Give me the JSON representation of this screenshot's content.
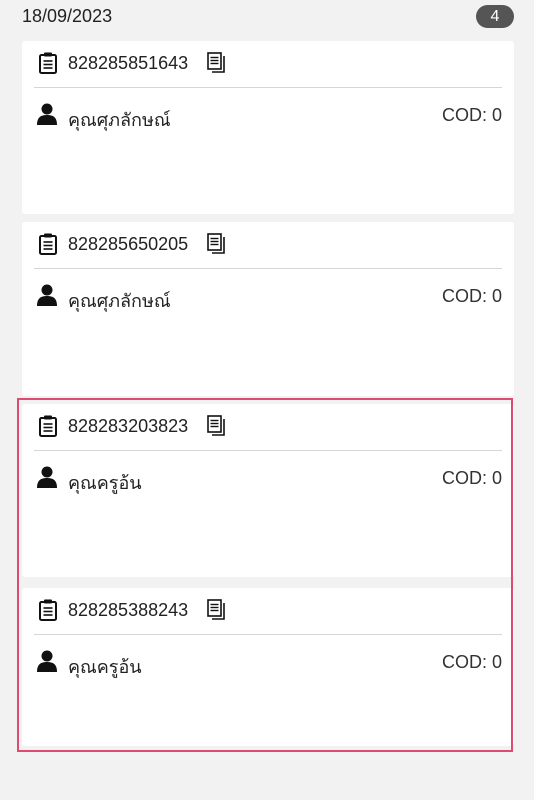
{
  "header": {
    "date": "18/09/2023",
    "count": "4"
  },
  "icons": {
    "clipboard": "clipboard-icon",
    "copy": "copy-icon",
    "person": "person-icon"
  },
  "colors": {
    "highlight": "#e04a6e",
    "badge": "#555555"
  },
  "cards": [
    {
      "tracking": "828285851643",
      "name": "คุณศุภลักษณ์",
      "cod": "COD: 0"
    },
    {
      "tracking": "828285650205",
      "name": "คุณศุภลักษณ์",
      "cod": "COD: 0"
    },
    {
      "tracking": "828283203823",
      "name": "คุณครูอ้น",
      "cod": "COD: 0"
    },
    {
      "tracking": "828285388243",
      "name": "คุณครูอ้น",
      "cod": "COD: 0"
    }
  ]
}
